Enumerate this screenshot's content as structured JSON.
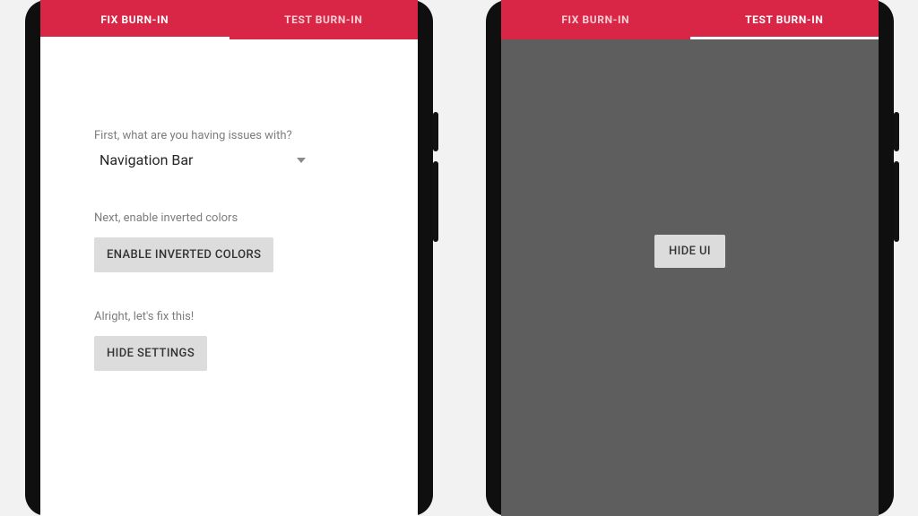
{
  "colors": {
    "accent": "#d92646",
    "button_bg": "#dcdcdc",
    "dark_bg": "#5e5e5e"
  },
  "left": {
    "tabs": {
      "fix": {
        "label": "FIX BURN-IN",
        "active": true
      },
      "test": {
        "label": "TEST BURN-IN",
        "active": false
      }
    },
    "step1": {
      "prompt": "First, what are you having issues with?",
      "selected": "Navigation Bar"
    },
    "step2": {
      "prompt": "Next, enable inverted colors",
      "button": "ENABLE INVERTED COLORS"
    },
    "step3": {
      "prompt": "Alright, let's fix this!",
      "button": "HIDE SETTINGS"
    }
  },
  "right": {
    "tabs": {
      "fix": {
        "label": "FIX BURN-IN",
        "active": false
      },
      "test": {
        "label": "TEST BURN-IN",
        "active": true
      }
    },
    "hide_ui_button": "HIDE UI"
  }
}
